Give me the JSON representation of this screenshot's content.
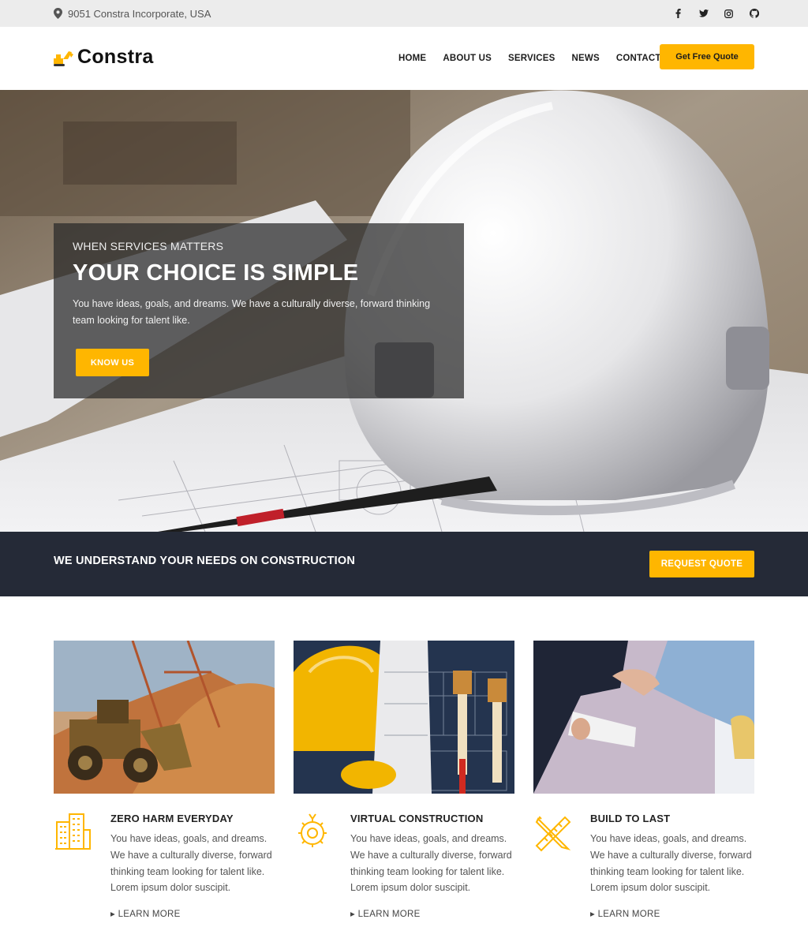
{
  "topbar": {
    "location_icon": "map-pin-icon",
    "address": "9051 Constra Incorporate, USA",
    "social": [
      "facebook-icon",
      "twitter-icon",
      "instagram-icon",
      "github-icon"
    ]
  },
  "header": {
    "logo_text": "Constra",
    "nav": [
      "HOME",
      "ABOUT US",
      "SERVICES",
      "NEWS",
      "CONTACT"
    ],
    "quote_button": "Get Free Quote"
  },
  "hero": {
    "subtitle": "WHEN SERVICES MATTERS",
    "title": "YOUR CHOICE IS SIMPLE",
    "text": "You have ideas, goals, and dreams. We have a culturally diverse, forward thinking team looking for talent like.",
    "button": "KNOW US"
  },
  "strip": {
    "text": "WE UNDERSTAND YOUR NEEDS ON CONSTRUCTION",
    "button": "REQUEST QUOTE"
  },
  "services": [
    {
      "icon": "building-icon",
      "title": "ZERO HARM EVERYDAY",
      "text": "You have ideas, goals, and dreams. We have a culturally diverse, forward thinking team looking for talent like. Lorem ipsum dolor suscipit.",
      "more": "LEARN MORE"
    },
    {
      "icon": "gear-wrench-icon",
      "title": "VIRTUAL CONSTRUCTION",
      "text": "You have ideas, goals, and dreams. We have a culturally diverse, forward thinking team looking for talent like. Lorem ipsum dolor suscipit.",
      "more": "LEARN MORE"
    },
    {
      "icon": "ruler-pencil-icon",
      "title": "BUILD TO LAST",
      "text": "You have ideas, goals, and dreams. We have a culturally diverse, forward thinking team looking for talent like. Lorem ipsum dolor suscipit.",
      "more": "LEARN MORE"
    }
  ],
  "colors": {
    "accent": "#ffb600",
    "dark_strip": "#252a37",
    "topbar": "#ececec"
  }
}
